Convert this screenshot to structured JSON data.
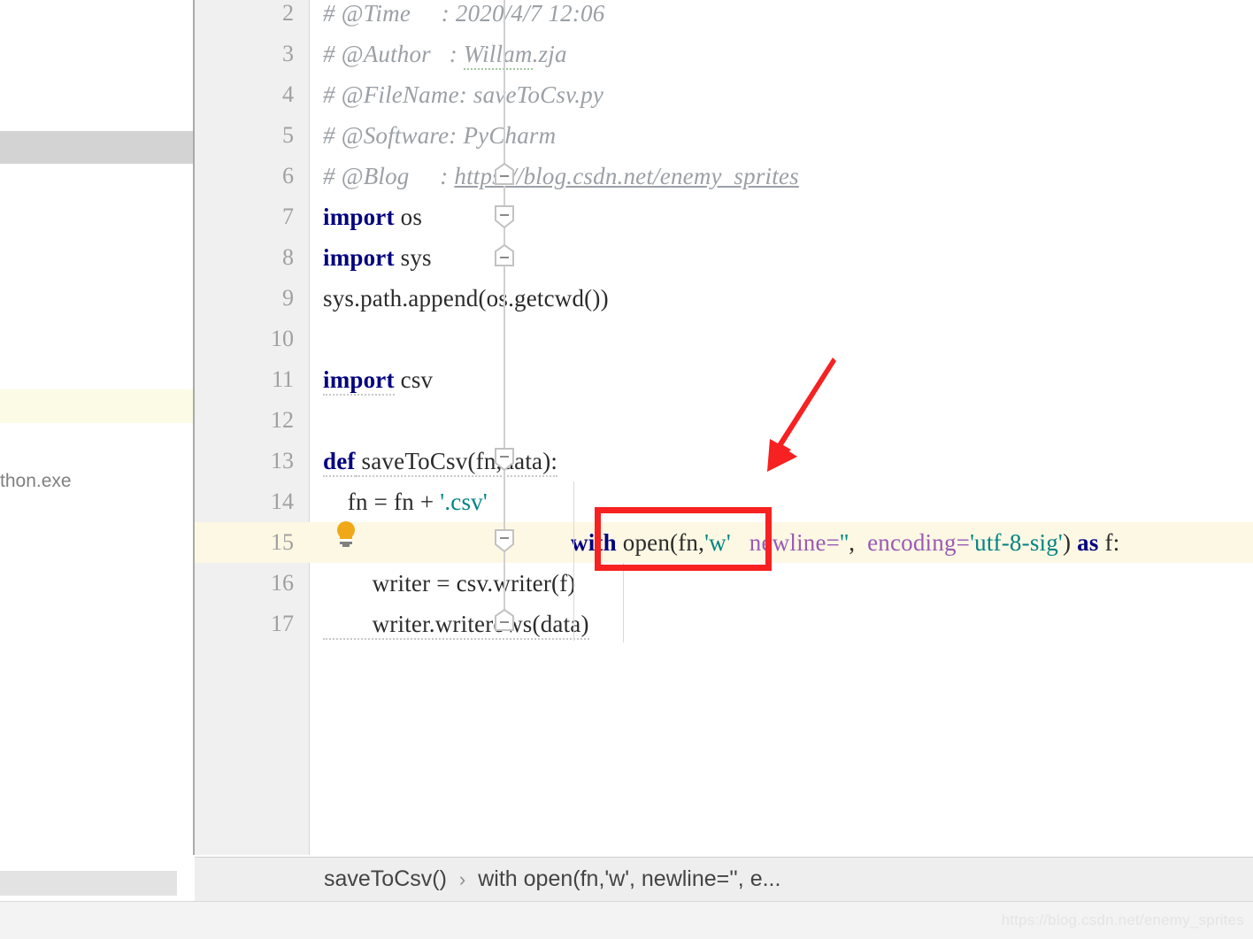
{
  "left_panel": {
    "visible_text": "thon.exe",
    "selected_row_color": "#d3d3d3",
    "highlight_row_color": "#fcfbe6"
  },
  "editor": {
    "first_visible_line": 2,
    "highlighted_line": 15,
    "lines": [
      {
        "no": "2",
        "text": "# @Time     : 2020/4/7 12:06"
      },
      {
        "no": "3",
        "text": "# @Author   : Willam.zja"
      },
      {
        "no": "4",
        "text": "# @FileName: saveToCsv.py"
      },
      {
        "no": "5",
        "text": "# @Software: PyCharm"
      },
      {
        "no": "6",
        "text": "# @Blog     : https://blog.csdn.net/enemy_sprites"
      },
      {
        "no": "7",
        "text": "import os"
      },
      {
        "no": "8",
        "text": "import sys"
      },
      {
        "no": "9",
        "text": "sys.path.append(os.getcwd())"
      },
      {
        "no": "10",
        "text": ""
      },
      {
        "no": "11",
        "text": "import csv"
      },
      {
        "no": "12",
        "text": ""
      },
      {
        "no": "13",
        "text": "def saveToCsv(fn,data):"
      },
      {
        "no": "14",
        "text": "    fn = fn + '.csv'"
      },
      {
        "no": "15",
        "text": "    with open(fn,'w', newline='', encoding='utf-8-sig') as f:"
      },
      {
        "no": "16",
        "text": "        writer = csv.writer(f)"
      },
      {
        "no": "17",
        "text": "        writer.writerows(data)"
      }
    ],
    "tokens": {
      "comment_time_key": "# @Time     : ",
      "comment_time_val": "2020/4/7 12:06",
      "comment_author_key": "# @Author   : ",
      "comment_author_val": "Willam",
      "comment_author_val2": ".zja",
      "comment_filename_key": "# @FileName: ",
      "comment_filename_val": "saveToCsv.py",
      "comment_software_key": "# @Software: ",
      "comment_software_val": "PyCharm",
      "comment_blog_key": "# @Blog     : ",
      "comment_blog_url": "https://blog.csdn.net/enemy_sprites",
      "kw_import": "import",
      "mod_os": " os",
      "mod_sys": " sys",
      "mod_csv": " csv",
      "call_syspath": "sys.path.append(os.getcwd())",
      "kw_def": "def",
      "def_sig": " saveToCsv(fn,data):",
      "assign_fn": "    fn = fn + ",
      "str_csv": "'.csv'",
      "kw_with": "with",
      "open_head": " open(fn,",
      "str_w": "'w'",
      "param_newline": "newline=",
      "str_empty": "''",
      "comma": ",",
      "param_encoding": "encoding=",
      "str_enc": "'utf-8-sig'",
      "paren_close": ")",
      "kw_as": "as",
      "as_f": " f:",
      "writer_assign": "        writer = csv.writer(f)",
      "writer_rows": "        writer.writerows(data)"
    },
    "colors": {
      "keyword": "#000080",
      "string": "#008484",
      "comment": "#9aa0a6",
      "parameter": "#9b59b6",
      "line_highlight": "#fdf8e3",
      "gutter": "#f0f0f0",
      "lineno": "#a0a0a0"
    }
  },
  "annotation": {
    "box_color": "#f72121",
    "box_target": "newline=''",
    "arrow_color": "#f72121",
    "arrow_points_to": "newline=''"
  },
  "icons": {
    "lightbulb": "lightbulb-icon",
    "fold_minus": "fold-collapse-icon",
    "breadcrumb_separator": "›"
  },
  "breadcrumb": {
    "items": [
      {
        "label": "saveToCsv()"
      },
      {
        "label": "with open(fn,'w', newline='', e..."
      }
    ],
    "separator": "›"
  },
  "watermark": {
    "text": "https://blog.csdn.net/enemy_sprites"
  }
}
